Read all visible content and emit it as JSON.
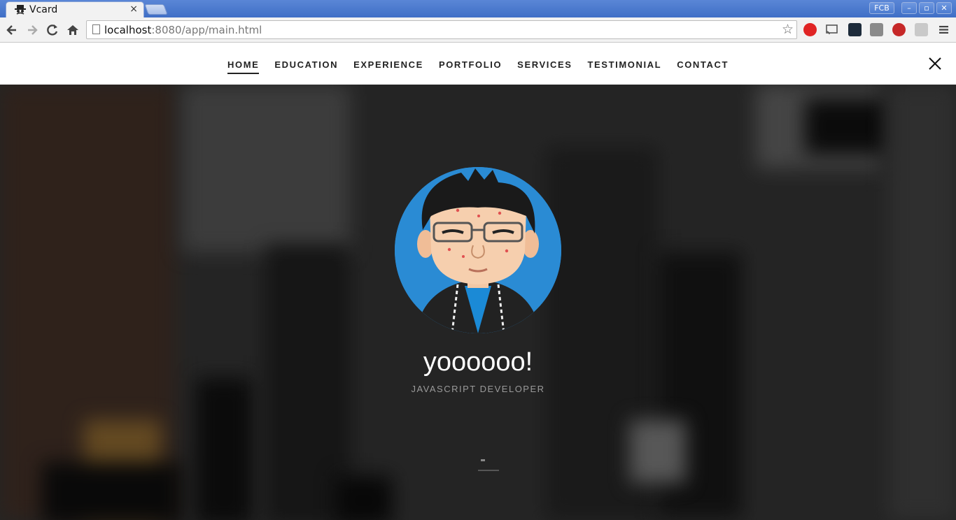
{
  "browser": {
    "tab_title": "Vcard",
    "tab_close": "×",
    "profile": "FCB",
    "url_host": "localhost",
    "url_rest": ":8080/app/main.html",
    "window_controls": {
      "minimize": "–",
      "maximize": "▫",
      "close": "✕"
    },
    "icons": [
      "back-icon",
      "forward-icon",
      "reload-icon",
      "home-icon",
      "bookmark-star-icon",
      "menu-icon"
    ]
  },
  "nav": {
    "items": [
      {
        "label": "HOME",
        "active": true
      },
      {
        "label": "EDUCATION"
      },
      {
        "label": "EXPERIENCE"
      },
      {
        "label": "PORTFOLIO"
      },
      {
        "label": "SERVICES"
      },
      {
        "label": "TESTIMONIAL"
      },
      {
        "label": "CONTACT"
      }
    ]
  },
  "hero": {
    "name": "yoooooo!",
    "role": "JAVASCRIPT DEVELOPER",
    "avatar_bg": "#2a8bd4"
  },
  "colors": {
    "titlebar": "#4a7ad0",
    "accent": "#222222"
  }
}
